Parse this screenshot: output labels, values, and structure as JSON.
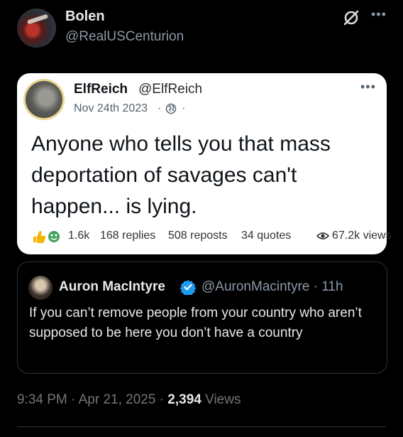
{
  "author": {
    "display_name": "Bolen",
    "handle": "@RealUSCenturion"
  },
  "icons": {
    "grok": "grok-slash-icon",
    "more": "more-horizontal-icon"
  },
  "quoted_tweet": {
    "display_name": "ElfReich",
    "handle": "@ElfReich",
    "date": "Nov 24th 2023",
    "separator": "·",
    "visibility_icon": "globe-icon",
    "text": "Anyone who tells you that mass deportation of savages can't happen... is lying.",
    "reactions_count": "1.6k",
    "replies": "168 replies",
    "reposts": "508 reposts",
    "quotes": "34 quotes",
    "views": "67.2k views"
  },
  "embedded_tweet": {
    "display_name": "Auron MacIntyre",
    "handle_time": "@AuronMacintyre · 11h",
    "text": "If you can’t remove people from your country who aren’t supposed to be here you don’t have a country",
    "verified_color": "#1d9bf0"
  },
  "footer": {
    "timestamp": "9:34 PM · Apr 21, 2025 · ",
    "views_count": "2,394",
    "views_label": " Views"
  },
  "colors": {
    "background": "#000000",
    "card_background": "#ffffff",
    "accent": "#1d9bf0"
  }
}
